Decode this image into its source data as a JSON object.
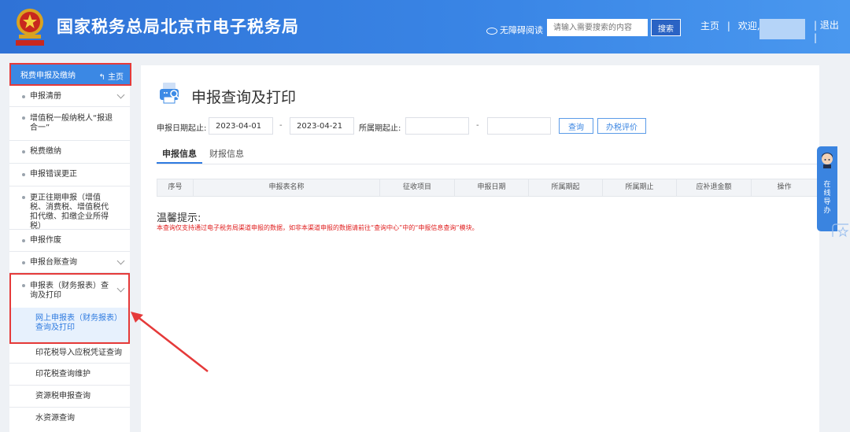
{
  "header": {
    "site_title": "国家税务总局北京市电子税务局",
    "accessibility_label": "无障碍阅读",
    "search_placeholder": "请输入需要搜索的内容",
    "search_button": "搜索",
    "home_link": "主页",
    "welcome": "欢迎,",
    "logout": "退出",
    "separator": "|"
  },
  "sidebar": {
    "header_label": "税费申报及缴纳",
    "home_label": "主页",
    "items": [
      {
        "label": "申报清册"
      },
      {
        "label": "增值税一般纳税人“报退合一”"
      },
      {
        "label": "税费缴纳"
      },
      {
        "label": "申报错误更正"
      },
      {
        "label": "更正往期申报（增值税、消费税、增值税代扣代缴、扣缴企业所得税）"
      },
      {
        "label": "申报作废"
      },
      {
        "label": "申报台账查询"
      },
      {
        "label": "申报表（财务报表）查询及打印"
      }
    ],
    "sub_items": [
      {
        "label": "网上申报表（财务报表）查询及打印"
      },
      {
        "label": "印花税导入应税凭证查询"
      },
      {
        "label": "印花税查询维护"
      },
      {
        "label": "资源税申报查询"
      },
      {
        "label": "水资源查询"
      }
    ]
  },
  "main": {
    "page_title": "申报查询及打印",
    "filters": {
      "declare_date_label": "申报日期起止:",
      "start_date": "2023-04-01",
      "end_date": "2023-04-21",
      "period_label": "所属期起止:",
      "dash": "-",
      "query_button": "查询",
      "rate_button": "办税评价"
    },
    "tabs": [
      {
        "label": "申报信息"
      },
      {
        "label": "财报信息"
      }
    ],
    "table_headers": [
      "序号",
      "申报表名称",
      "征收项目",
      "申报日期",
      "所属期起",
      "所属期止",
      "应补退金额",
      "操作"
    ],
    "tip_title": "温馨提示:",
    "tip_text": "本查询仅支持通过电子税务局渠道申报的数据，如非本渠道申报的数据请前往“查询中心”中的“申报信息查询”模块。"
  },
  "float_help": {
    "label": "在线导办"
  },
  "colors": {
    "header_blue": "#3a86e6",
    "accent_blue": "#2f7be0",
    "highlight_red": "#e53a3a",
    "tip_red": "#e02020"
  }
}
